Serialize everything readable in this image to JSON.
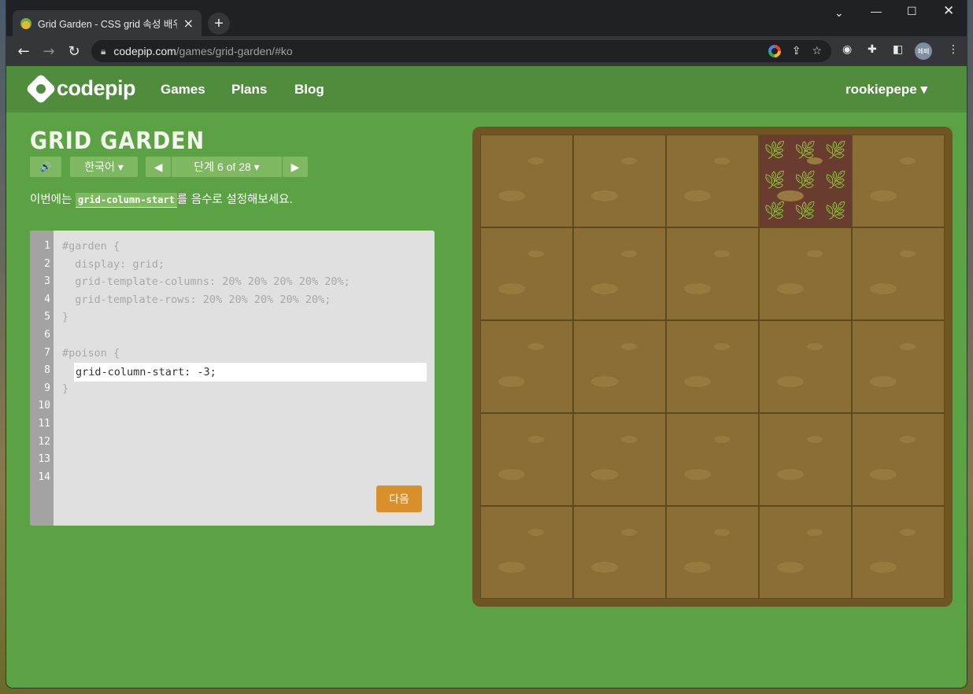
{
  "browser": {
    "tab_title": "Grid Garden - CSS grid 속성 배우기",
    "tab_close": "×",
    "new_tab": "+",
    "url_domain": "codepip.com",
    "url_path": "/games/grid-garden/#ko",
    "avatar_text": "페페"
  },
  "site": {
    "logo": "codepip",
    "nav": [
      "Games",
      "Plans",
      "Blog"
    ],
    "user": "rookiepepe ▾"
  },
  "game": {
    "title": "GRID GARDEN",
    "sound_icon": "🔊",
    "language": "한국어 ▾",
    "prev": "◀",
    "level": "단계 6 of 28 ▾",
    "next_arrow": "▶",
    "instruction_pre": "이번에는 ",
    "instruction_code": "grid-column-start",
    "instruction_post": "를 음수로 설정해보세요.",
    "next_button": "다음"
  },
  "editor": {
    "line_numbers": [
      "1",
      "2",
      "3",
      "4",
      "5",
      "6",
      "7",
      "8",
      "9",
      "10",
      "11",
      "12",
      "13",
      "14"
    ],
    "lines": [
      "#garden {",
      "  display: grid;",
      "  grid-template-columns: 20% 20% 20% 20% 20%;",
      "  grid-template-rows: 20% 20% 20% 20% 20%;",
      "}",
      "",
      "#poison {",
      "",
      "}"
    ],
    "input_value": "grid-column-start: -3;"
  },
  "garden": {
    "columns": 5,
    "rows": 5,
    "poison_column": 4,
    "poison_row": 1,
    "colors": {
      "soil": "#8b6e35",
      "border": "#6e5523",
      "poison": "#6a3b2f",
      "weed": "#8fd43a"
    }
  }
}
